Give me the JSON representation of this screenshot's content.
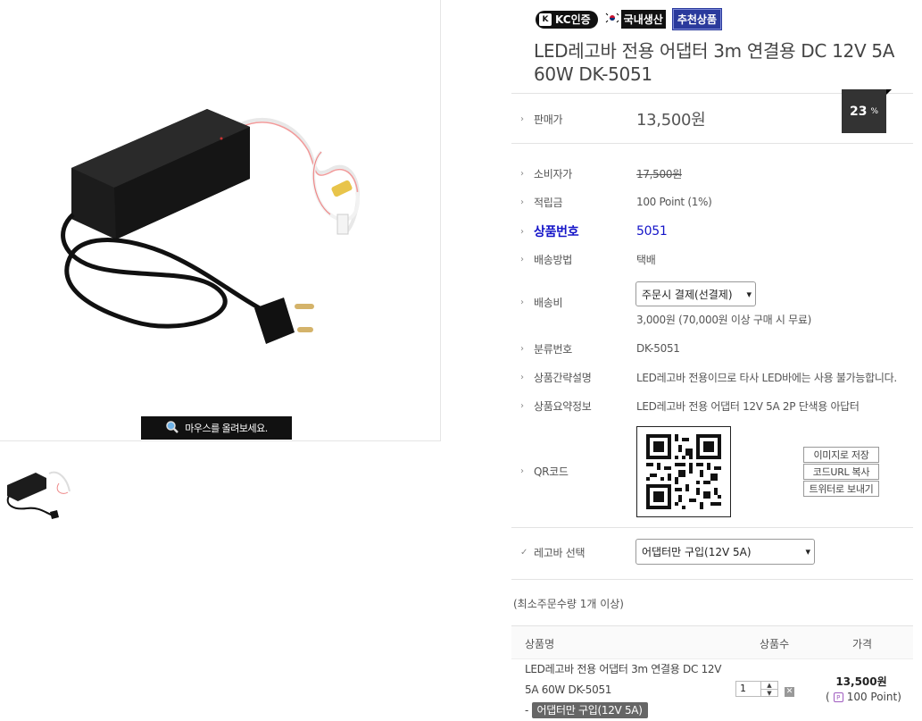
{
  "gallery": {
    "zoom_hint": "마우스를 올려보세요."
  },
  "badges": {
    "kc": "KC인증",
    "kc_mark": "K",
    "local": "국내생산",
    "recommended": "추천상품"
  },
  "product": {
    "title": "LED레고바 전용 어댑터 3m 연결용 DC 12V 5A 60W DK-5051",
    "discount_rate": "23",
    "discount_unit": "%"
  },
  "info": {
    "sale_label": "판매가",
    "sale_value": "13,500원",
    "consumer_label": "소비자가",
    "consumer_value": "17,500원",
    "points_label": "적립금",
    "points_value": "100 Point (1%)",
    "product_no_label": "상품번호",
    "product_no_value": "5051",
    "shipping_method_label": "배송방법",
    "shipping_method_value": "택배",
    "shipping_fee_label": "배송비",
    "shipping_fee_select": "주문시 결제(선결제)",
    "shipping_fee_note": "3,000원 (70,000원 이상 구매 시 무료)",
    "category_no_label": "분류번호",
    "category_no_value": "DK-5051",
    "short_desc_label": "상품간략설명",
    "short_desc_value": "LED레고바 전용이므로 타사 LED바에는 사용 불가능합니다.",
    "summary_label": "상품요약정보",
    "summary_value": "LED레고바 전용 어댑터 12V 5A 2P 단색용 아답터",
    "qr_label": "QR코드",
    "qr_buttons": [
      "이미지로 저장",
      "코드URL 복사",
      "트위터로 보내기"
    ],
    "option_label": "레고바 선택",
    "option_select": "어댑터만 구입(12V 5A)"
  },
  "order": {
    "min_qty": "(최소주문수량 1개 이상)",
    "col_name": "상품명",
    "col_qty": "상품수",
    "col_price": "가격",
    "item_name": "LED레고바 전용 어댑터 3m 연결용 DC 12V 5A 60W DK-5051",
    "item_option_prefix": "-",
    "item_option": "어댑터만 구입(12V 5A)",
    "item_qty": "1",
    "item_price": "13,500원",
    "item_point": "100 Point)",
    "item_point_prefix": "("
  }
}
